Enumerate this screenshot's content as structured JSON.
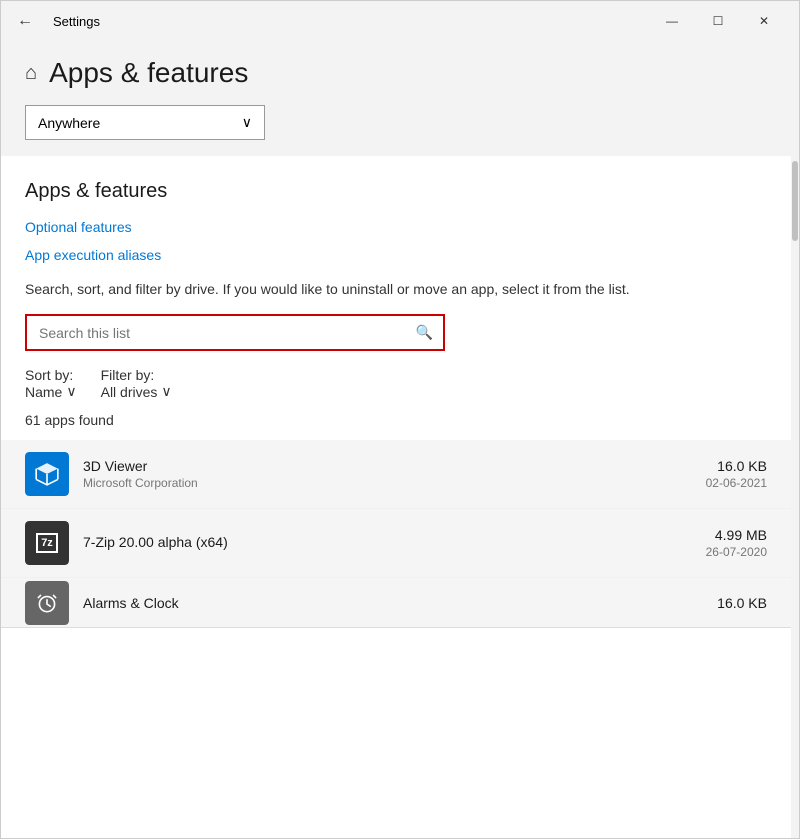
{
  "window": {
    "title": "Settings",
    "controls": {
      "minimize": "—",
      "maximize": "☐",
      "close": "✕"
    }
  },
  "header": {
    "page_title": "Apps & features",
    "home_icon": "⌂"
  },
  "dropdown": {
    "value": "Anywhere",
    "chevron": "∨"
  },
  "section": {
    "title": "Apps & features",
    "links": [
      {
        "label": "Optional features",
        "id": "optional-features"
      },
      {
        "label": "App execution aliases",
        "id": "app-execution-aliases"
      }
    ],
    "description": "Search, sort, and filter by drive. If you would like to uninstall or move an app, select it from the list."
  },
  "search": {
    "placeholder": "Search this list",
    "icon": "🔍"
  },
  "sort_filter": {
    "sort_label": "Sort by:",
    "sort_value": "Name",
    "sort_chevron": "∨",
    "filter_label": "Filter by:",
    "filter_value": "All drives",
    "filter_chevron": "∨"
  },
  "apps_count": {
    "text": "61 apps found"
  },
  "apps": [
    {
      "name": "3D Viewer",
      "publisher": "Microsoft Corporation",
      "size": "16.0 KB",
      "date": "02-06-2021",
      "icon_type": "3dviewer"
    },
    {
      "name": "7-Zip 20.00 alpha (x64)",
      "publisher": "",
      "size": "4.99 MB",
      "date": "26-07-2020",
      "icon_type": "7zip"
    },
    {
      "name": "Alarms & Clock",
      "publisher": "",
      "size": "16.0 KB",
      "date": "",
      "icon_type": "alarms"
    }
  ]
}
